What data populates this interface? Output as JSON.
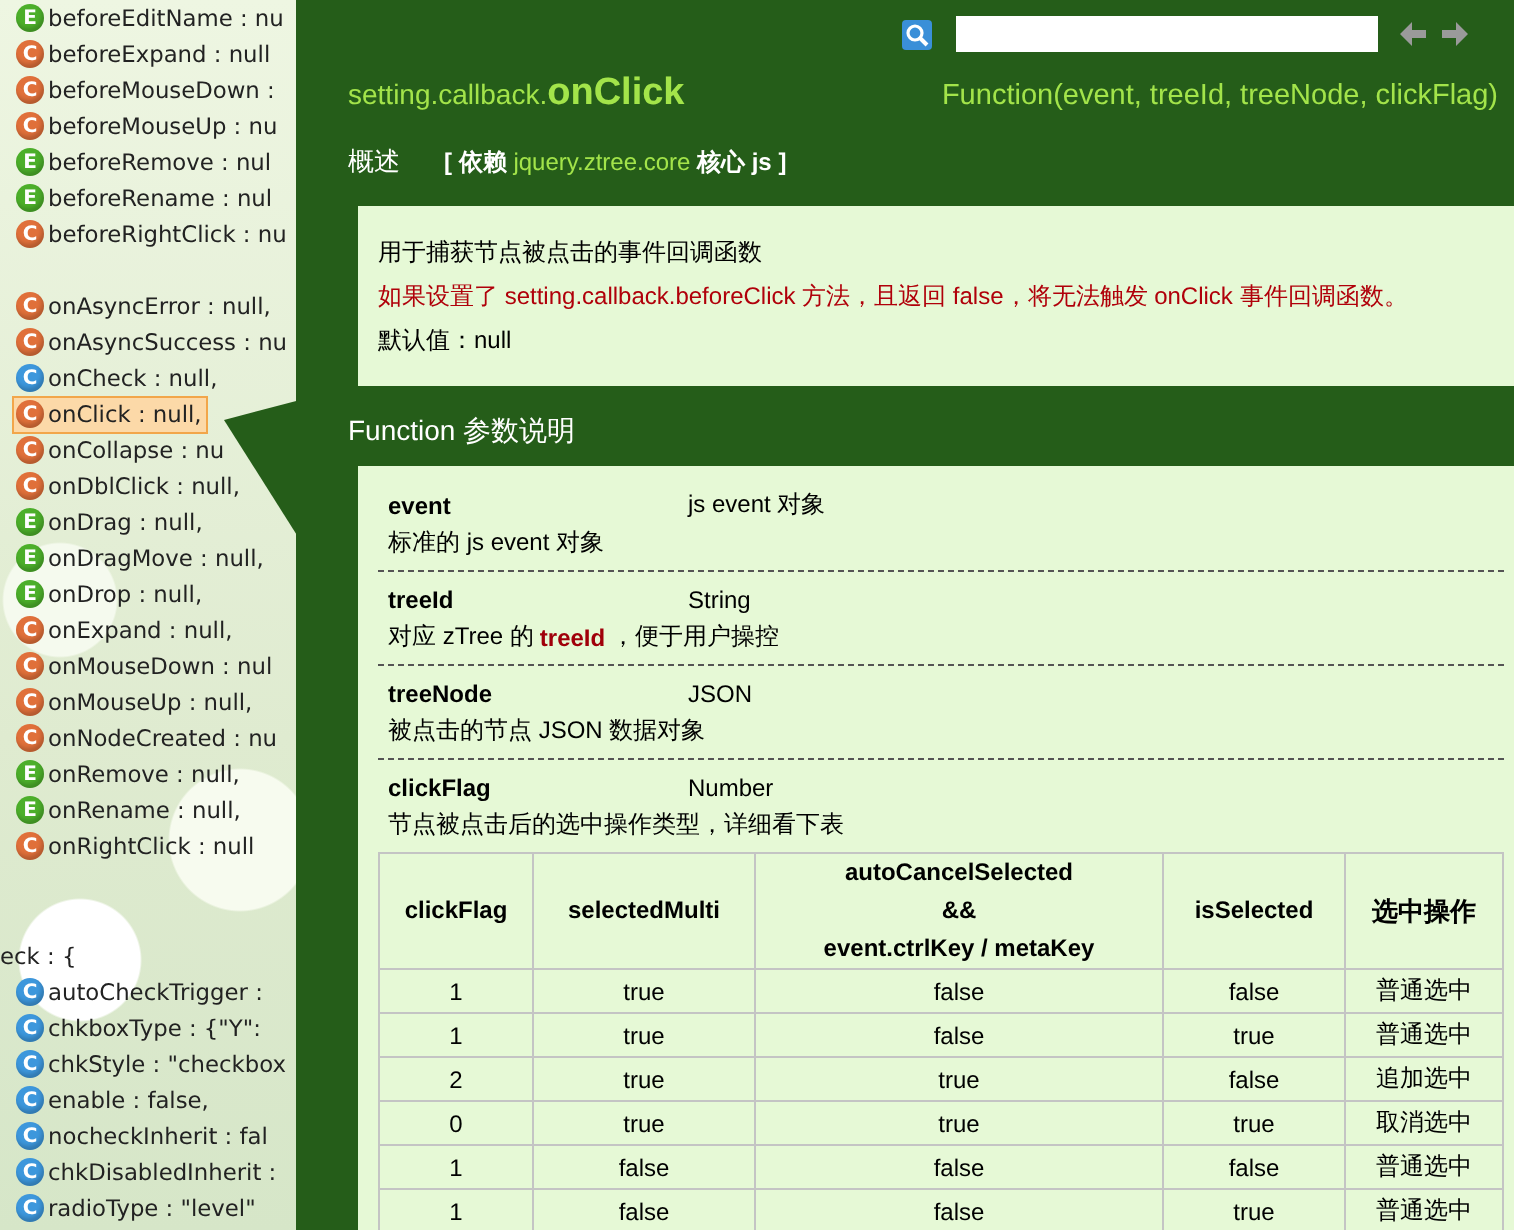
{
  "tree": {
    "groups": [
      {
        "items": [
          {
            "badge": "E",
            "kind": "event",
            "label": "beforeEditName : nu",
            "selected": false
          },
          {
            "badge": "C",
            "kind": "callback",
            "label": "beforeExpand : null",
            "selected": false
          },
          {
            "badge": "C",
            "kind": "callback",
            "label": "beforeMouseDown :",
            "selected": false
          },
          {
            "badge": "C",
            "kind": "callback",
            "label": "beforeMouseUp : nu",
            "selected": false
          },
          {
            "badge": "E",
            "kind": "event",
            "label": "beforeRemove : nul",
            "selected": false
          },
          {
            "badge": "E",
            "kind": "event",
            "label": "beforeRename : nul",
            "selected": false
          },
          {
            "badge": "C",
            "kind": "callback",
            "label": "beforeRightClick : nu",
            "selected": false
          }
        ]
      },
      {
        "items": [
          {
            "badge": "C",
            "kind": "callback",
            "label": "onAsyncError : null,",
            "selected": false
          },
          {
            "badge": "C",
            "kind": "callback",
            "label": "onAsyncSuccess : nu",
            "selected": false
          },
          {
            "badge": "C",
            "kind": "config",
            "label": "onCheck : null,",
            "selected": false
          },
          {
            "badge": "C",
            "kind": "callback",
            "label": "onClick : null,",
            "selected": true
          },
          {
            "badge": "C",
            "kind": "callback",
            "label": "onCollapse : nu",
            "selected": false
          },
          {
            "badge": "C",
            "kind": "callback",
            "label": "onDblClick : null,",
            "selected": false
          },
          {
            "badge": "E",
            "kind": "event",
            "label": "onDrag : null,",
            "selected": false
          },
          {
            "badge": "E",
            "kind": "event",
            "label": "onDragMove : null,",
            "selected": false
          },
          {
            "badge": "E",
            "kind": "event",
            "label": "onDrop : null,",
            "selected": false
          },
          {
            "badge": "C",
            "kind": "callback",
            "label": "onExpand : null,",
            "selected": false
          },
          {
            "badge": "C",
            "kind": "callback",
            "label": "onMouseDown : nul",
            "selected": false
          },
          {
            "badge": "C",
            "kind": "callback",
            "label": "onMouseUp : null,",
            "selected": false
          },
          {
            "badge": "C",
            "kind": "callback",
            "label": "onNodeCreated : nu",
            "selected": false
          },
          {
            "badge": "E",
            "kind": "event",
            "label": "onRemove : null,",
            "selected": false
          },
          {
            "badge": "E",
            "kind": "event",
            "label": "onRename : null,",
            "selected": false
          },
          {
            "badge": "C",
            "kind": "callback",
            "label": "onRightClick : null",
            "selected": false
          }
        ]
      },
      {
        "header": "eck : {",
        "items": [
          {
            "badge": "C",
            "kind": "config",
            "label": "autoCheckTrigger :",
            "selected": false
          },
          {
            "badge": "C",
            "kind": "config",
            "label": "chkboxType : {\"Y\":",
            "selected": false
          },
          {
            "badge": "C",
            "kind": "config",
            "label": "chkStyle : \"checkbox",
            "selected": false
          },
          {
            "badge": "C",
            "kind": "config",
            "label": "enable : false,",
            "selected": false
          },
          {
            "badge": "C",
            "kind": "config",
            "label": "nocheckInherit : fal",
            "selected": false
          },
          {
            "badge": "C",
            "kind": "config",
            "label": "chkDisabledInherit :",
            "selected": false
          },
          {
            "badge": "C",
            "kind": "config",
            "label": "radioType : \"level\"",
            "selected": false
          }
        ]
      }
    ]
  },
  "panel": {
    "title_prefix": "setting.callback.",
    "title_name": "onClick",
    "signature": "Function(event, treeId, treeNode, clickFlag)",
    "overview_label": "概述",
    "dependency": [
      {
        "text": "[ 依赖",
        "accent": false
      },
      {
        "text": "jquery.ztree.core",
        "accent": true
      },
      {
        "text": "核心 js ]",
        "accent": false
      }
    ],
    "description": [
      {
        "text": "用于捕获节点被点击的事件回调函数",
        "kind": "normal"
      },
      {
        "text": "如果设置了 setting.callback.beforeClick 方法，且返回 false，将无法触发 onClick 事件回调函数。",
        "kind": "warning"
      },
      {
        "text": "默认值：null",
        "kind": "normal"
      }
    ],
    "params_heading": "Function 参数说明",
    "params": [
      {
        "name": "event",
        "type": "js event 对象",
        "desc": "标准的 js event 对象"
      },
      {
        "name": "treeId",
        "type": "String",
        "desc": "对应 zTree 的 **treeId**，便于用户操控"
      },
      {
        "name": "treeNode",
        "type": "JSON",
        "desc": "被点击的节点 JSON 数据对象"
      },
      {
        "name": "clickFlag",
        "type": "Number",
        "desc": "节点被点击后的选中操作类型，详细看下表"
      }
    ],
    "table": {
      "columns": [
        "clickFlag",
        "selectedMulti",
        "autoCancelSelected\n&&\nevent.ctrlKey / metaKey",
        "isSelected",
        "选中操作"
      ],
      "rows": [
        [
          "1",
          "true",
          "false",
          "false",
          "普通选中"
        ],
        [
          "1",
          "true",
          "false",
          "true",
          "普通选中"
        ],
        [
          "2",
          "true",
          "true",
          "false",
          "追加选中"
        ],
        [
          "0",
          "true",
          "true",
          "true",
          "取消选中"
        ],
        [
          "1",
          "false",
          "false",
          "false",
          "普通选中"
        ],
        [
          "1",
          "false",
          "false",
          "true",
          "普通选中"
        ]
      ]
    }
  }
}
